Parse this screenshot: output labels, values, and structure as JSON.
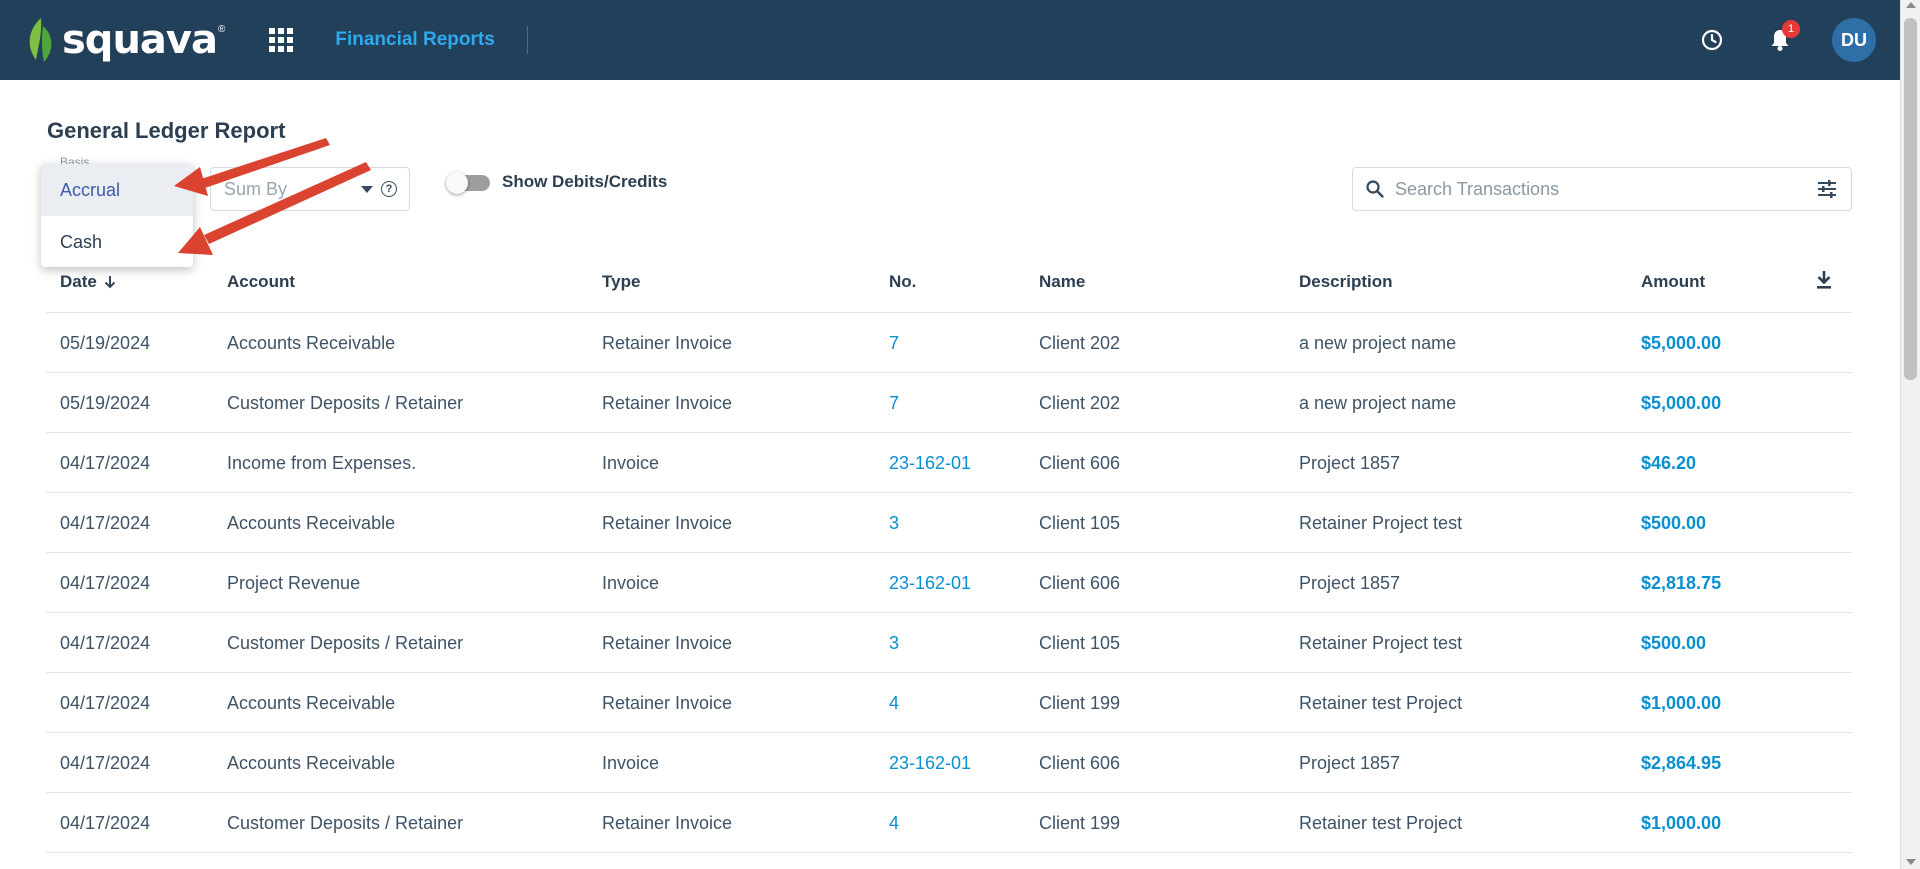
{
  "header": {
    "brand": "squava",
    "brand_mark": "®",
    "nav_title": "Financial Reports",
    "notification_count": "1",
    "user_initials": "DU",
    "colors": {
      "bar": "#22405a",
      "accent": "#2eaaf0",
      "badge": "#e53935",
      "avatar": "#2f6fa8"
    }
  },
  "page": {
    "title": "General Ledger Report",
    "basis_label": "Basis",
    "sum_by_placeholder": "Sum By",
    "help": "?",
    "toggle_label": "Show Debits/Credits",
    "toggle_on": false,
    "search_placeholder": "Search Transactions"
  },
  "basis_dropdown": {
    "options": [
      {
        "label": "Accrual",
        "selected": true
      },
      {
        "label": "Cash",
        "selected": false
      }
    ]
  },
  "annotation": {
    "arrows": 2,
    "color": "#d9432f"
  },
  "table": {
    "columns": [
      "Date",
      "Account",
      "Type",
      "No.",
      "Name",
      "Description",
      "Amount"
    ],
    "sort_column": "Date",
    "sort_direction": "descending",
    "rows": [
      {
        "date": "05/19/2024",
        "account": "Accounts Receivable",
        "type": "Retainer Invoice",
        "no": "7",
        "name": "Client 202",
        "description": "a new project name",
        "amount": "$5,000.00"
      },
      {
        "date": "05/19/2024",
        "account": "Customer Deposits / Retainer",
        "type": "Retainer Invoice",
        "no": "7",
        "name": "Client 202",
        "description": "a new project name",
        "amount": "$5,000.00"
      },
      {
        "date": "04/17/2024",
        "account": "Income from Expenses.",
        "type": "Invoice",
        "no": "23-162-01",
        "name": "Client 606",
        "description": "Project 1857",
        "amount": "$46.20"
      },
      {
        "date": "04/17/2024",
        "account": "Accounts Receivable",
        "type": "Retainer Invoice",
        "no": "3",
        "name": "Client 105",
        "description": "Retainer Project test",
        "amount": "$500.00"
      },
      {
        "date": "04/17/2024",
        "account": "Project Revenue",
        "type": "Invoice",
        "no": "23-162-01",
        "name": "Client 606",
        "description": "Project 1857",
        "amount": "$2,818.75"
      },
      {
        "date": "04/17/2024",
        "account": "Customer Deposits / Retainer",
        "type": "Retainer Invoice",
        "no": "3",
        "name": "Client 105",
        "description": "Retainer Project test",
        "amount": "$500.00"
      },
      {
        "date": "04/17/2024",
        "account": "Accounts Receivable",
        "type": "Retainer Invoice",
        "no": "4",
        "name": "Client 199",
        "description": "Retainer test Project",
        "amount": "$1,000.00"
      },
      {
        "date": "04/17/2024",
        "account": "Accounts Receivable",
        "type": "Invoice",
        "no": "23-162-01",
        "name": "Client 606",
        "description": "Project 1857",
        "amount": "$2,864.95"
      },
      {
        "date": "04/17/2024",
        "account": "Customer Deposits / Retainer",
        "type": "Retainer Invoice",
        "no": "4",
        "name": "Client 199",
        "description": "Retainer test Project",
        "amount": "$1,000.00"
      }
    ]
  }
}
